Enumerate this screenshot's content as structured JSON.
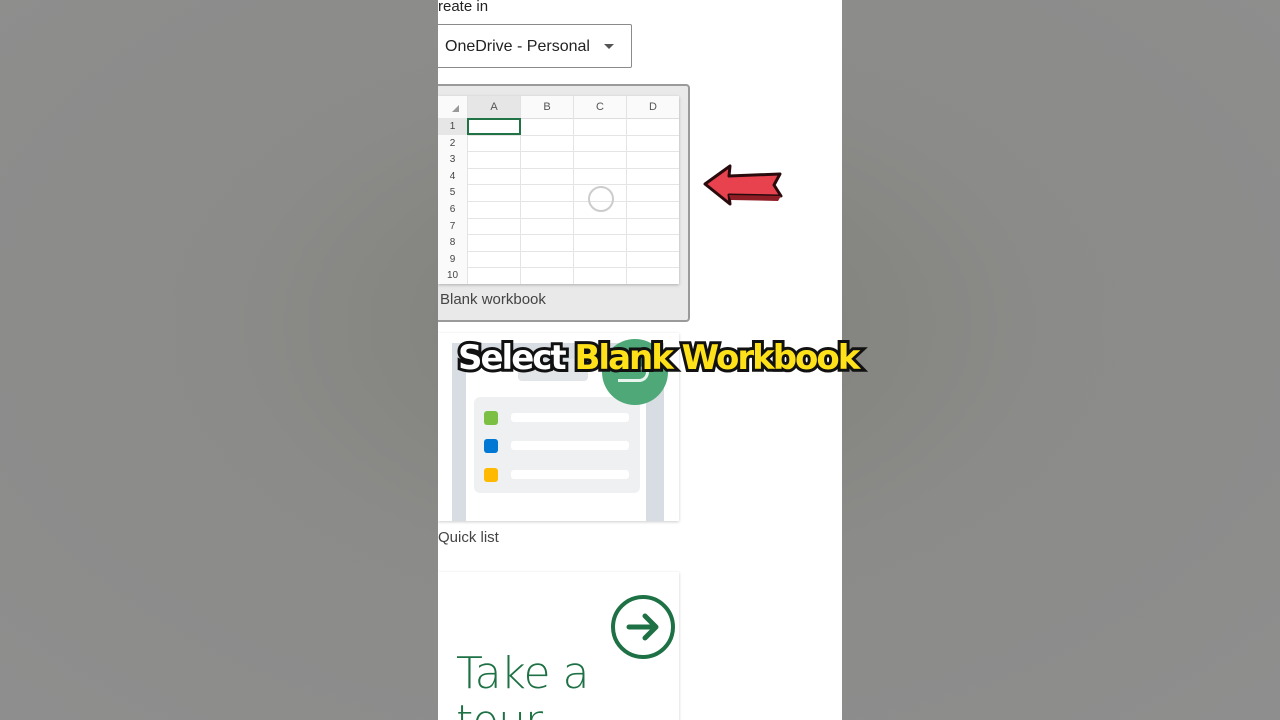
{
  "create_in": {
    "label": "reate in",
    "location_value": "OneDrive - Personal"
  },
  "templates": [
    {
      "label": "Blank workbook",
      "columns": [
        "A",
        "B",
        "C",
        "D"
      ],
      "rows": [
        "1",
        "2",
        "3",
        "4",
        "5",
        "6",
        "7",
        "8",
        "9",
        "10"
      ]
    },
    {
      "label": "Quick list"
    },
    {
      "label": "Take a tour",
      "line1": "Take a",
      "line2": "tour"
    }
  ],
  "overlay": {
    "caption_white": "Select",
    "caption_yellow": "Blank Workbook",
    "arrow_color": "#e8424f"
  },
  "colors": {
    "excel_green": "#217346",
    "tour_green": "#1e7145",
    "quick_list_dots": [
      "#7bc043",
      "#0078d4",
      "#ffb900"
    ]
  }
}
